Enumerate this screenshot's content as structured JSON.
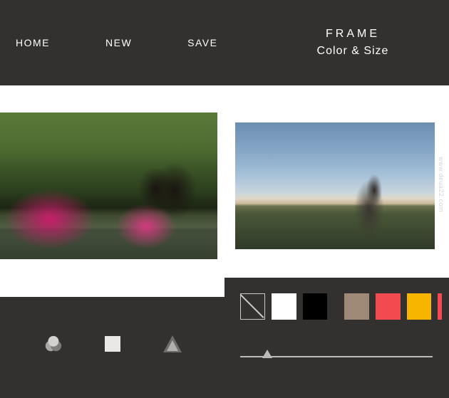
{
  "top_nav": {
    "home": "HOME",
    "new": "NEW",
    "save": "SAVE"
  },
  "panel_title": {
    "line1": "FRAME",
    "line2": "Color & Size"
  },
  "swatches": [
    {
      "name": "none",
      "color": "transparent"
    },
    {
      "name": "white",
      "color": "#ffffff"
    },
    {
      "name": "black",
      "color": "#000000"
    },
    {
      "name": "taupe",
      "color": "#9d8975"
    },
    {
      "name": "red",
      "color": "#f24a4e"
    },
    {
      "name": "amber",
      "color": "#f7b500"
    }
  ],
  "slider": {
    "min": 0,
    "max": 100,
    "value": 14
  },
  "watermark": "www.deua22.com"
}
